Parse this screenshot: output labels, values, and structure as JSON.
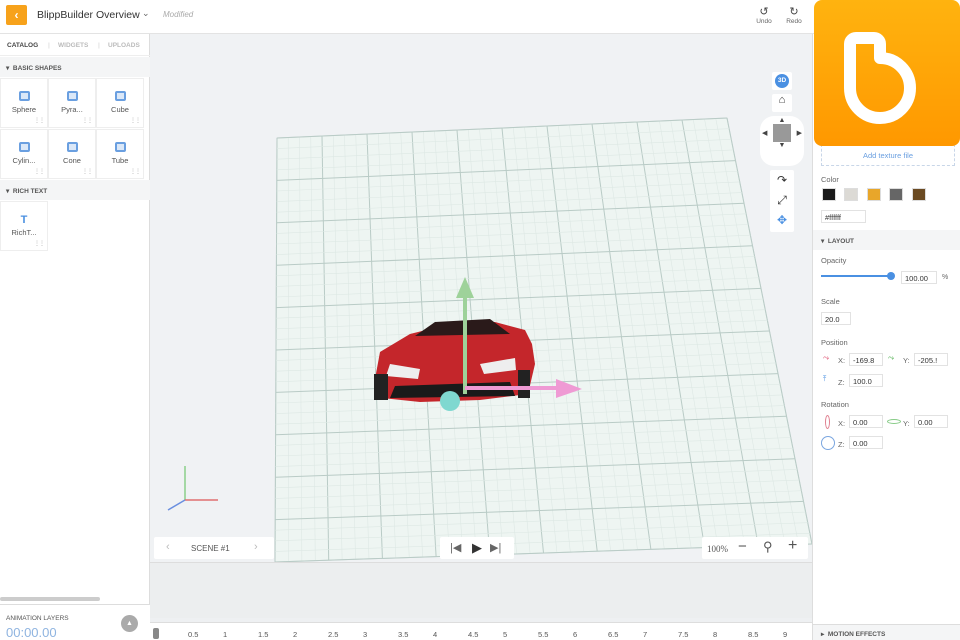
{
  "header": {
    "back_icon": "chevron-left",
    "title": "BlippBuilder Overview",
    "status": "Modified",
    "undo": "Undo",
    "redo": "Redo"
  },
  "left": {
    "tabs": [
      "CATALOG",
      "WIDGETS",
      "UPLOADS"
    ],
    "basic_shapes_title": "BASIC SHAPES",
    "shapes": [
      "Sphere",
      "Pyra...",
      "Cube",
      "Cylin...",
      "Cone",
      "Tube"
    ],
    "rich_text_title": "RICH TEXT",
    "rich_text_items": [
      "RichT..."
    ],
    "rich_text_icon": "T",
    "animation_layers": "ANIMATION LAYERS",
    "time": "00:00.00"
  },
  "canvas": {
    "view_3d": "3D",
    "scene": "SCENE #1",
    "zoom": "100%"
  },
  "timeline": {
    "ticks": [
      "0.5",
      "1",
      "1.5",
      "2",
      "2.5",
      "3",
      "3.5",
      "4",
      "4.5",
      "5",
      "5.5",
      "6",
      "6.5",
      "7",
      "7.5",
      "8",
      "8.5",
      "9"
    ]
  },
  "right": {
    "add_texture": "Add texture file",
    "color_label": "Color",
    "swatches": [
      "#1a1a1a",
      "#dcdad5",
      "#e8a62a",
      "#666666",
      "#6b4a22"
    ],
    "color_value": "#ffffff",
    "layout_title": "LAYOUT",
    "opacity_label": "Opacity",
    "opacity_value": "100.00",
    "opacity_unit": "%",
    "opacity_fraction": 1.0,
    "scale_label": "Scale",
    "scale_value": "20.0",
    "position_label": "Position",
    "pos_x_label": "X:",
    "pos_x": "-169.8",
    "pos_y_label": "Y:",
    "pos_y": "-205.!",
    "pos_z_label": "Z:",
    "pos_z": "100.0",
    "rotation_label": "Rotation",
    "rot_x_label": "X:",
    "rot_x": "0.00",
    "rot_y_label": "Y:",
    "rot_y": "0.00",
    "rot_z_label": "Z:",
    "rot_z": "0.00",
    "motion_effects": "MOTION EFFECTS"
  },
  "colors": {
    "accent": "#f7a21b",
    "blue": "#4a90e2"
  }
}
